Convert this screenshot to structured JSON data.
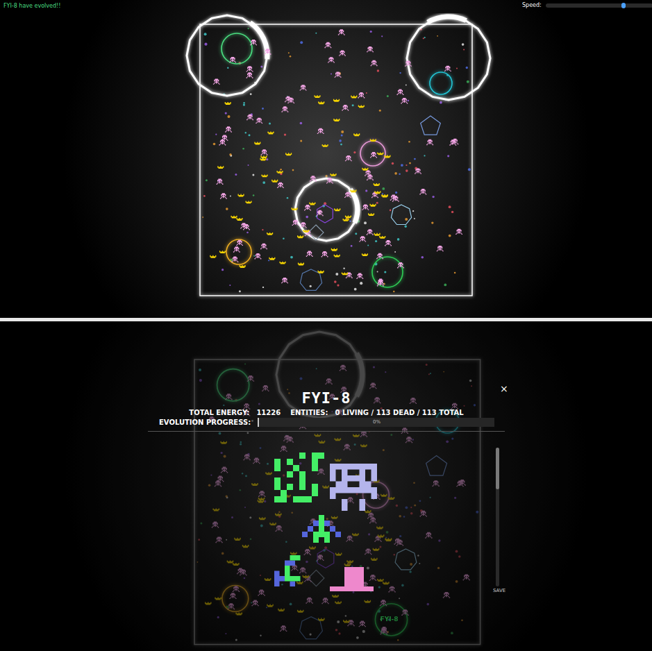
{
  "notification": "FYI-8 have evolved!!",
  "speed": {
    "label": "Speed:",
    "level": 0.73
  },
  "arena": {
    "rings": [
      {
        "kind": "zone",
        "color": "#ffffff"
      },
      {
        "kind": "zone",
        "color": "#ffffff"
      },
      {
        "kind": "zone",
        "color": "#ffffff"
      },
      {
        "kind": "ring",
        "color": "#4ade80"
      },
      {
        "kind": "ring",
        "color": "#22c5d5"
      },
      {
        "kind": "ring",
        "color": "#e89ad8"
      },
      {
        "kind": "ring",
        "color": "#f0b020"
      },
      {
        "kind": "ring",
        "color": "#2ecc55"
      },
      {
        "kind": "polygon",
        "color": "#8844dd"
      },
      {
        "kind": "polygon",
        "color": "#9ad0ee"
      },
      {
        "kind": "polygon",
        "color": "#7799dd"
      },
      {
        "kind": "polygon",
        "color": "#8899aa"
      },
      {
        "kind": "polygon",
        "color": "#5577aa"
      }
    ],
    "species": [
      {
        "kind": "skull",
        "color": "#f4a6e6"
      },
      {
        "kind": "crown",
        "color": "#f5d400"
      }
    ]
  },
  "modal": {
    "title": "FYI-8",
    "close": "×",
    "stats": [
      {
        "label": "TOTAL ENERGY:",
        "value": "11226"
      },
      {
        "label": "ENTITIES:",
        "value": "0 LIVING / 113 DEAD / 113 TOTAL"
      }
    ],
    "progress": {
      "label": "EVOLUTION PROGRESS:",
      "reading": "0%",
      "level": 0
    },
    "creatures": [
      {
        "color": "#44ee66"
      },
      {
        "color": "#b4b4ec"
      },
      {
        "color": "#5566dd"
      },
      {
        "color": "#5566dd"
      },
      {
        "color": "#ee88cc"
      }
    ],
    "save": "SAVE"
  },
  "tag": "FYI-8"
}
